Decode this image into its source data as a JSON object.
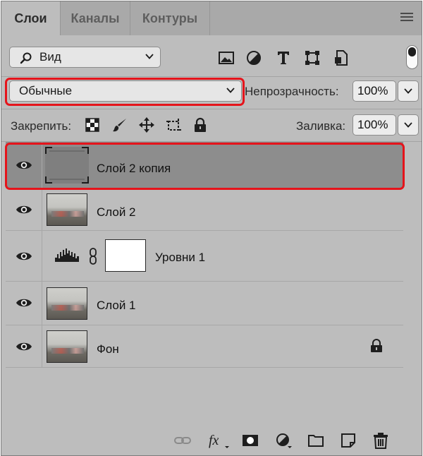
{
  "tabs": [
    {
      "label": "Слои",
      "active": true
    },
    {
      "label": "Каналы",
      "active": false
    },
    {
      "label": "Контуры",
      "active": false
    }
  ],
  "filter": {
    "kind_value": "Вид",
    "icons": [
      "image-filter-icon",
      "adjustment-filter-icon",
      "type-filter-icon",
      "shape-filter-icon",
      "smart-object-filter-icon"
    ]
  },
  "blend": {
    "mode": "Обычные",
    "opacity_label": "Непрозрачность:",
    "opacity_value": "100%"
  },
  "lock": {
    "label": "Закрепить:",
    "icons": [
      "lock-transparent-icon",
      "lock-pixels-icon",
      "lock-position-icon",
      "lock-artboard-icon",
      "lock-all-icon"
    ],
    "fill_label": "Заливка:",
    "fill_value": "100%"
  },
  "layers": [
    {
      "name": "Слой 2 копия",
      "selected": true,
      "thumbnail": "gray-empty",
      "visible": true
    },
    {
      "name": "Слой 2",
      "selected": false,
      "thumbnail": "photo",
      "visible": true
    },
    {
      "name": "Уровни 1",
      "selected": false,
      "thumbnail": "adjustment-levels",
      "visible": true
    },
    {
      "name": "Слой 1",
      "selected": false,
      "thumbnail": "photo",
      "visible": true
    },
    {
      "name": "Фон",
      "selected": false,
      "thumbnail": "photo",
      "visible": true,
      "locked": true
    }
  ],
  "bottom_toolbar": [
    "link-icon",
    "fx-icon",
    "mask-icon",
    "adjustment-layer-icon",
    "folder-icon",
    "new-layer-icon",
    "trash-icon"
  ],
  "colors": {
    "highlight": "#e5141b",
    "panel_bg": "#bdbdbd",
    "selected_layer_bg": "#8d8d8d"
  }
}
